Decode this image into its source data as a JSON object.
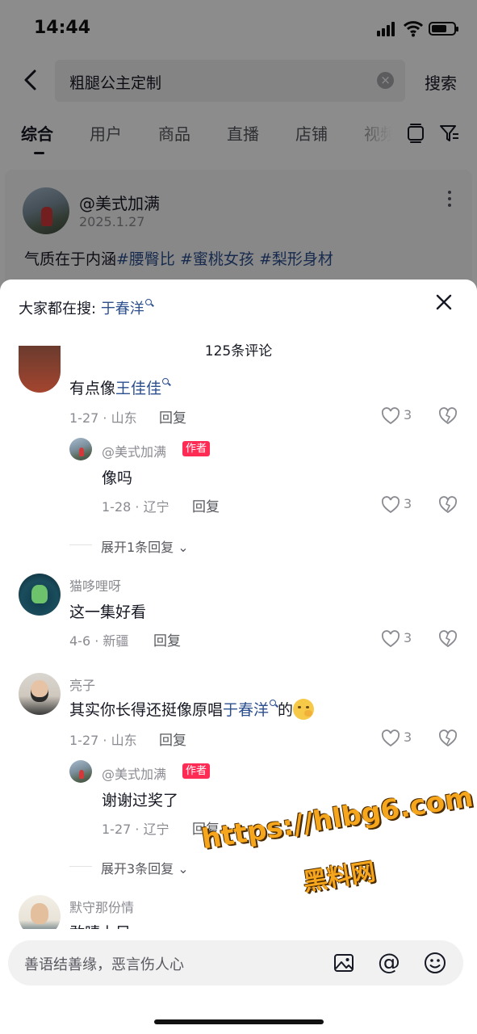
{
  "status": {
    "time": "14:44"
  },
  "search": {
    "query": "粗腿公主定制",
    "button": "搜索"
  },
  "tabs": [
    "综合",
    "用户",
    "商品",
    "直播",
    "店铺",
    "视频"
  ],
  "post": {
    "author": "@美式加满",
    "date": "2025.1.27",
    "desc_plain": "气质在于内涵",
    "tags": [
      "#腰臀比",
      "#蜜桃女孩",
      "#梨形身材"
    ]
  },
  "sheet": {
    "hot_label": "大家都在搜:",
    "hot_keyword": "于春洋",
    "count": "125条评论"
  },
  "comments": [
    {
      "text_plain": "有点像",
      "text_kw": "王佳佳",
      "meta": "1-27 · 山东",
      "reply": "回复",
      "likes": "3",
      "sub": {
        "name": "@美式加满",
        "badge": "作者",
        "text": "像吗",
        "meta": "1-28 · 辽宁",
        "reply": "回复",
        "likes": "3"
      },
      "expand": "展开1条回复"
    },
    {
      "name": "猫哆哩呀",
      "text": "这一集好看",
      "meta": "4-6 · 新疆",
      "reply": "回复",
      "likes": "3"
    },
    {
      "name": "亮子",
      "text_plain": "其实你长得还挺像原唱",
      "text_kw": "于春洋",
      "text_tail": "的",
      "meta": "1-27 · 山东",
      "reply": "回复",
      "likes": "3",
      "sub": {
        "name": "@美式加满",
        "badge": "作者",
        "text": "谢谢过奖了",
        "meta": "1-27 · 辽宁",
        "reply": "回复"
      },
      "expand": "展开3条回复"
    },
    {
      "name": "默守那份情",
      "text": "敢晴上目"
    }
  ],
  "watermark": {
    "line1": "https://hlbg6.com",
    "line2": "黑料网"
  },
  "input": {
    "placeholder": "善语结善缘，恶言伤人心",
    "at": "@"
  }
}
